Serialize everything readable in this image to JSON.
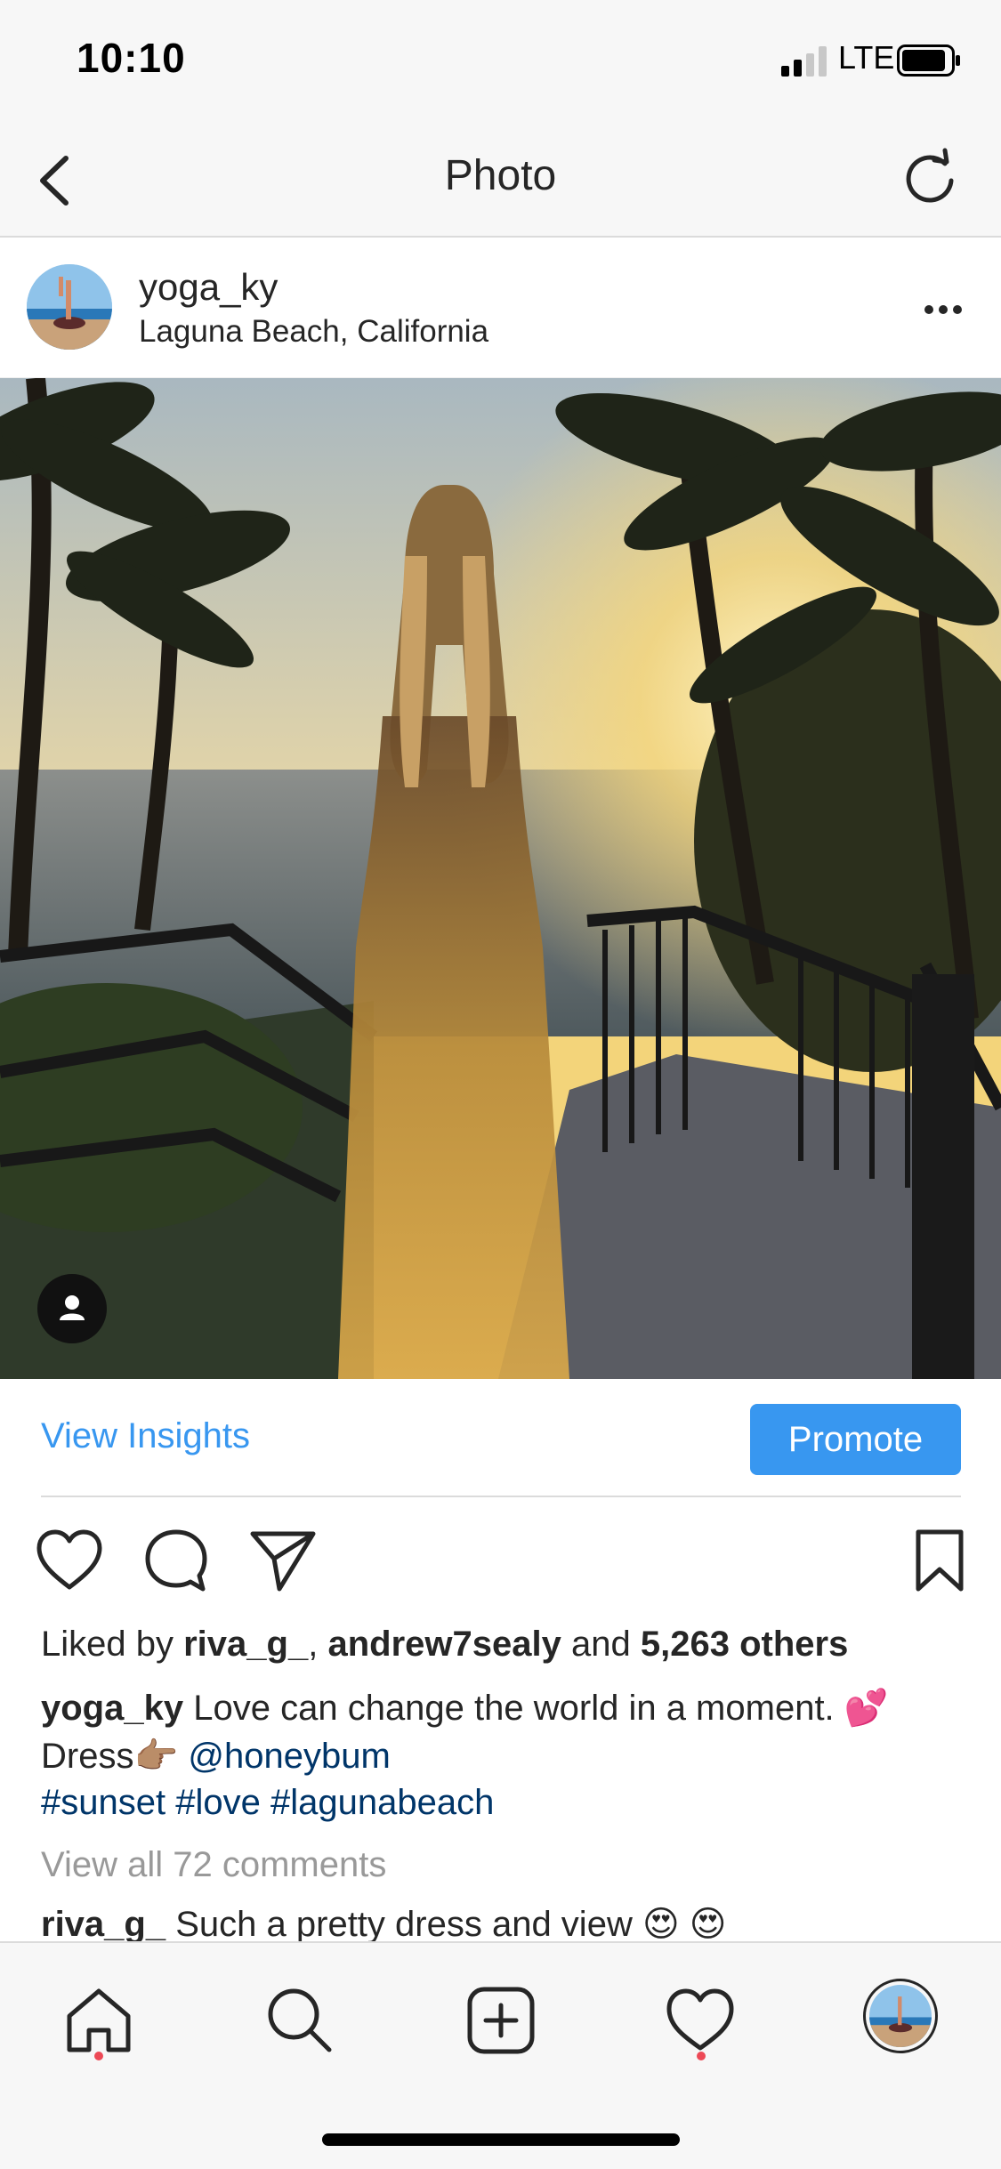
{
  "status_bar": {
    "time": "10:10",
    "network": "LTE"
  },
  "nav": {
    "title": "Photo"
  },
  "post": {
    "username": "yoga_ky",
    "location": "Laguna Beach, California",
    "view_insights": "View Insights",
    "promote": "Promote",
    "likes": {
      "prefix": "Liked by",
      "user1": "riva_g_",
      "user2": "andrew7sealy",
      "joiner": "and",
      "others": "5,263 others"
    },
    "caption": {
      "author": "yoga_ky",
      "text": "Love can change the world in a moment. 💕",
      "line2_text": "Dress👉🏽",
      "mention": "@honeybum",
      "hashtags": [
        "#sunset",
        "#love",
        "#lagunabeach"
      ]
    },
    "view_comments": "View all 72 comments",
    "first_comment": {
      "user": "riva_g_",
      "text": "Such a pretty dress and view 😍 😍"
    }
  },
  "icons": {
    "back": "chevron-left-icon",
    "refresh": "refresh-icon",
    "more": "more-horizontal-icon",
    "like": "heart-icon",
    "comment": "comment-icon",
    "share": "send-icon",
    "save": "bookmark-icon",
    "tag": "user-tag-icon"
  },
  "tab_bar": [
    "home-icon",
    "search-icon",
    "new-post-icon",
    "activity-icon",
    "profile-avatar"
  ],
  "colors": {
    "accent": "#3897f0",
    "link": "#003569",
    "notification": "#ed4956"
  }
}
